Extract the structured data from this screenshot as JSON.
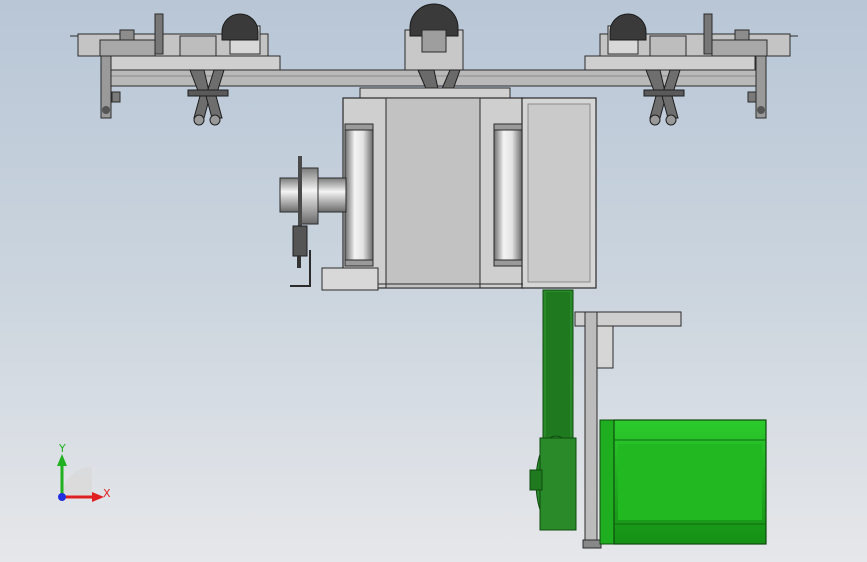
{
  "viewport": {
    "background_top": "#b8c6d6",
    "background_bottom": "#e6e7ea"
  },
  "triad": {
    "x_label": "X",
    "y_label": "Y",
    "x_color": "#e02020",
    "y_color": "#20b020",
    "z_color": "#2030e0"
  },
  "colors": {
    "steel_light": "#c9c9c9",
    "steel_mid": "#a6a6a6",
    "steel_dark": "#5a5a5a",
    "outline": "#2b2b2b",
    "motor_green": "#1fae1f",
    "motor_green_dark": "#0f7a0f",
    "belt_green": "#2a8a2a"
  },
  "icons": {
    "triad": "coordinate-triad-icon"
  }
}
